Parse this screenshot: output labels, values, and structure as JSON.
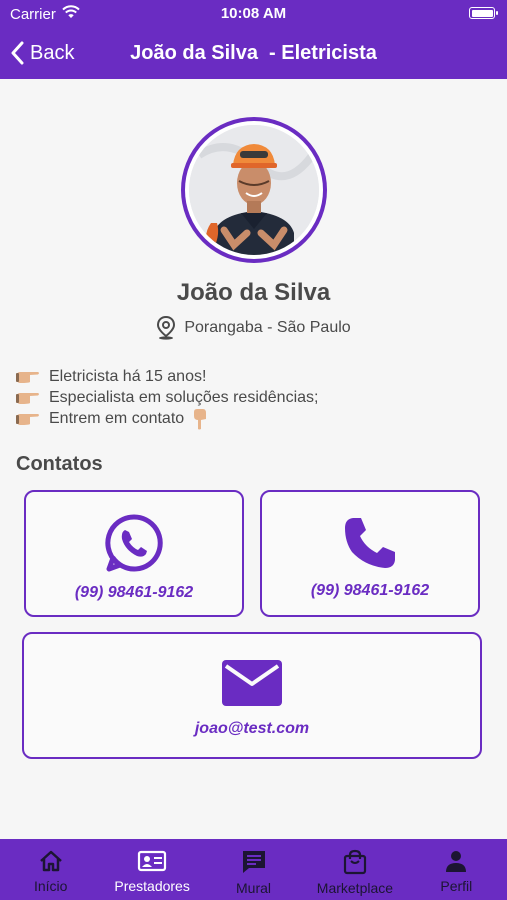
{
  "status": {
    "carrier": "Carrier",
    "time": "10:08 AM"
  },
  "nav": {
    "back_label": "Back",
    "title": "João da Silva  - Eletricista"
  },
  "profile": {
    "name": "João da Silva",
    "location": "Porangaba - São Paulo",
    "bio": [
      "Eletricista há 15 anos!",
      "Especialista em soluções residências;",
      "Entrem em contato"
    ]
  },
  "contacts": {
    "title": "Contatos",
    "whatsapp": "(99) 98461-9162",
    "phone": "(99) 98461-9162",
    "email": "joao@test.com"
  },
  "tabs": [
    {
      "label": "Início",
      "icon": "home-icon"
    },
    {
      "label": "Prestadores",
      "icon": "id-card-icon"
    },
    {
      "label": "Mural",
      "icon": "chat-icon"
    },
    {
      "label": "Marketplace",
      "icon": "shopping-bag-icon"
    },
    {
      "label": "Perfil",
      "icon": "person-icon"
    }
  ],
  "colors": {
    "accent": "#6a2cc2",
    "background": "#f6f6f6",
    "text": "#4a4a4a"
  }
}
